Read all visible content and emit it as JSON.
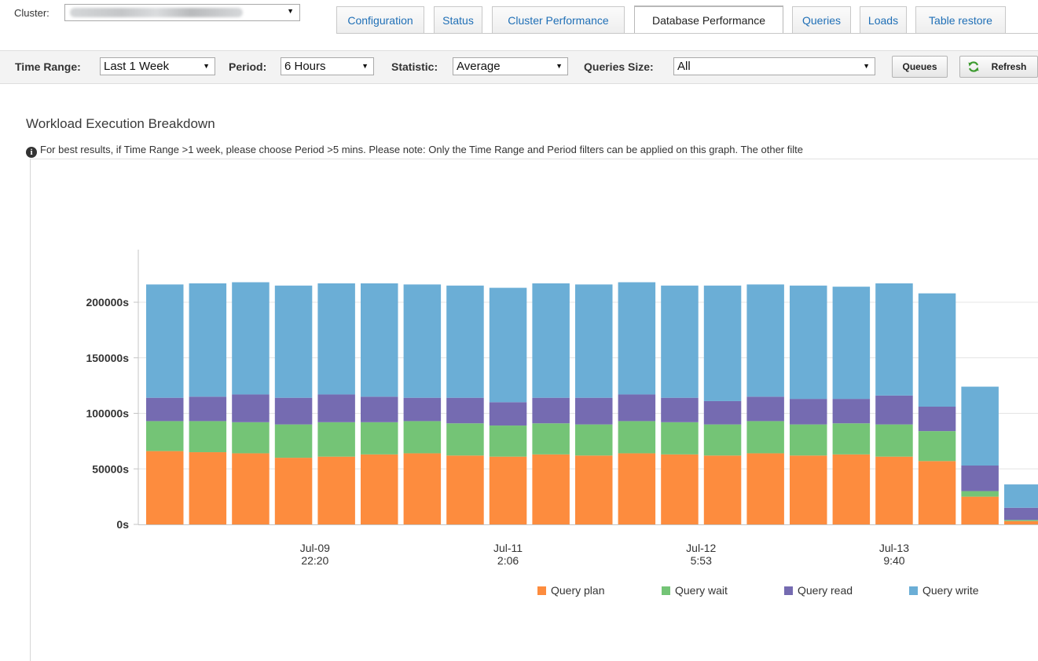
{
  "topbar": {
    "cluster_label": "Cluster:",
    "tabs": [
      {
        "label": "Configuration"
      },
      {
        "label": "Status"
      },
      {
        "label": "Cluster Performance"
      },
      {
        "label": "Database Performance",
        "active": true
      },
      {
        "label": "Queries"
      },
      {
        "label": "Loads"
      },
      {
        "label": "Table restore"
      }
    ]
  },
  "filters": {
    "time_range_label": "Time Range:",
    "time_range_value": "Last 1 Week",
    "period_label": "Period:",
    "period_value": "6 Hours",
    "statistic_label": "Statistic:",
    "statistic_value": "Average",
    "queries_size_label": "Queries Size:",
    "queries_size_value": "All",
    "queues_button": "Queues",
    "refresh_button": "Refresh"
  },
  "section": {
    "title": "Workload Execution Breakdown",
    "info": "For best results, if Time Range >1 week, please choose Period >5 mins. Please note: Only the Time Range and Period filters can be applied on this graph. The other filte"
  },
  "chart_data": {
    "type": "bar",
    "stacked": true,
    "y_tick_labels": [
      "0s",
      "50000s",
      "100000s",
      "150000s",
      "200000s"
    ],
    "y_ticks": [
      0,
      50000,
      100000,
      150000,
      200000
    ],
    "ylim": [
      0,
      245000
    ],
    "x_tick_labels": [
      {
        "line1": "Jul-09",
        "line2": "22:20",
        "index": 3.5
      },
      {
        "line1": "Jul-11",
        "line2": "2:06",
        "index": 8
      },
      {
        "line1": "Jul-12",
        "line2": "5:53",
        "index": 12.5
      },
      {
        "line1": "Jul-13",
        "line2": "9:40",
        "index": 17
      }
    ],
    "series": [
      {
        "name": "Query plan",
        "color": "#fd8c3e",
        "values": [
          66000,
          65000,
          64000,
          60000,
          61000,
          63000,
          64000,
          62000,
          61000,
          63000,
          62000,
          64000,
          63000,
          62000,
          64000,
          62000,
          63000,
          61000,
          57000,
          25000,
          3000
        ]
      },
      {
        "name": "Query wait",
        "color": "#74c476",
        "values": [
          27000,
          28000,
          28000,
          30000,
          31000,
          29000,
          29000,
          29000,
          28000,
          28000,
          28000,
          29000,
          29000,
          28000,
          29000,
          28000,
          28000,
          29000,
          27000,
          5000,
          1000
        ]
      },
      {
        "name": "Query read",
        "color": "#756bb1",
        "values": [
          21000,
          22000,
          25000,
          24000,
          25000,
          23000,
          21000,
          23000,
          21000,
          23000,
          24000,
          24000,
          22000,
          21000,
          22000,
          23000,
          22000,
          26000,
          22000,
          23000,
          11000
        ]
      },
      {
        "name": "Query write",
        "color": "#6baed6",
        "values": [
          102000,
          102000,
          101000,
          101000,
          100000,
          102000,
          102000,
          101000,
          103000,
          103000,
          102000,
          101000,
          101000,
          104000,
          101000,
          102000,
          101000,
          101000,
          102000,
          71000,
          21000
        ]
      }
    ]
  }
}
